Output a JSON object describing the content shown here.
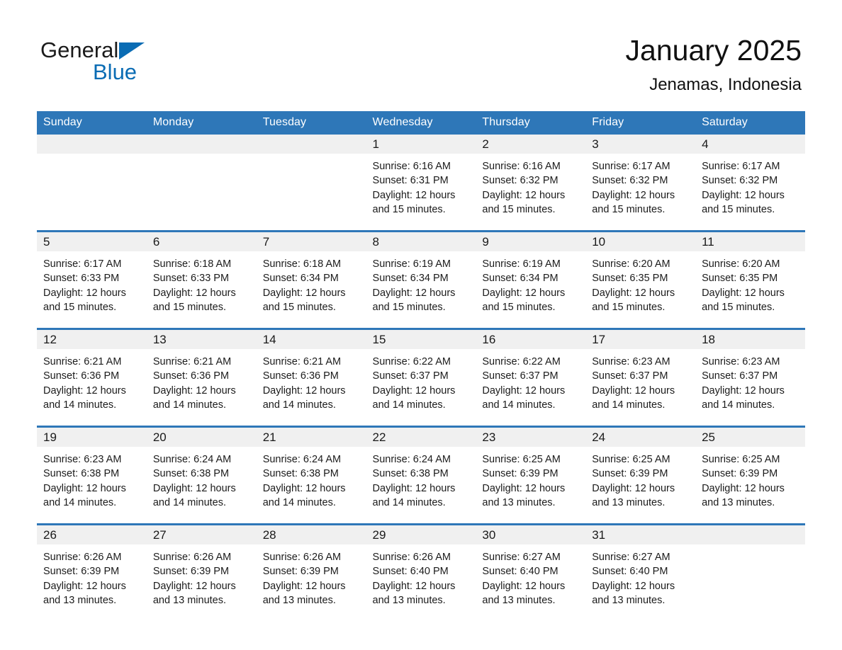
{
  "logo": {
    "word1": "General",
    "word2": "Blue",
    "triangle_color": "#0a6cb4",
    "triangle_name": "logo-triangle-icon"
  },
  "header": {
    "title": "January 2025",
    "subtitle": "Jenamas, Indonesia"
  },
  "theme": {
    "header_blue": "#2E77B8",
    "row_separator_blue": "#2E77B8",
    "daynum_band": "#f0f0f0",
    "text": "#1b1b1b",
    "header_text": "#ffffff"
  },
  "weekday_headers": [
    "Sunday",
    "Monday",
    "Tuesday",
    "Wednesday",
    "Thursday",
    "Friday",
    "Saturday"
  ],
  "weeks": [
    {
      "days": [
        {
          "num": "",
          "sunrise": "",
          "sunset": "",
          "daylight": "",
          "blank": true
        },
        {
          "num": "",
          "sunrise": "",
          "sunset": "",
          "daylight": "",
          "blank": true
        },
        {
          "num": "",
          "sunrise": "",
          "sunset": "",
          "daylight": "",
          "blank": true
        },
        {
          "num": "1",
          "sunrise": "Sunrise: 6:16 AM",
          "sunset": "Sunset: 6:31 PM",
          "daylight": "Daylight: 12 hours and 15 minutes.",
          "blank": false
        },
        {
          "num": "2",
          "sunrise": "Sunrise: 6:16 AM",
          "sunset": "Sunset: 6:32 PM",
          "daylight": "Daylight: 12 hours and 15 minutes.",
          "blank": false
        },
        {
          "num": "3",
          "sunrise": "Sunrise: 6:17 AM",
          "sunset": "Sunset: 6:32 PM",
          "daylight": "Daylight: 12 hours and 15 minutes.",
          "blank": false
        },
        {
          "num": "4",
          "sunrise": "Sunrise: 6:17 AM",
          "sunset": "Sunset: 6:32 PM",
          "daylight": "Daylight: 12 hours and 15 minutes.",
          "blank": false
        }
      ]
    },
    {
      "days": [
        {
          "num": "5",
          "sunrise": "Sunrise: 6:17 AM",
          "sunset": "Sunset: 6:33 PM",
          "daylight": "Daylight: 12 hours and 15 minutes.",
          "blank": false
        },
        {
          "num": "6",
          "sunrise": "Sunrise: 6:18 AM",
          "sunset": "Sunset: 6:33 PM",
          "daylight": "Daylight: 12 hours and 15 minutes.",
          "blank": false
        },
        {
          "num": "7",
          "sunrise": "Sunrise: 6:18 AM",
          "sunset": "Sunset: 6:34 PM",
          "daylight": "Daylight: 12 hours and 15 minutes.",
          "blank": false
        },
        {
          "num": "8",
          "sunrise": "Sunrise: 6:19 AM",
          "sunset": "Sunset: 6:34 PM",
          "daylight": "Daylight: 12 hours and 15 minutes.",
          "blank": false
        },
        {
          "num": "9",
          "sunrise": "Sunrise: 6:19 AM",
          "sunset": "Sunset: 6:34 PM",
          "daylight": "Daylight: 12 hours and 15 minutes.",
          "blank": false
        },
        {
          "num": "10",
          "sunrise": "Sunrise: 6:20 AM",
          "sunset": "Sunset: 6:35 PM",
          "daylight": "Daylight: 12 hours and 15 minutes.",
          "blank": false
        },
        {
          "num": "11",
          "sunrise": "Sunrise: 6:20 AM",
          "sunset": "Sunset: 6:35 PM",
          "daylight": "Daylight: 12 hours and 15 minutes.",
          "blank": false
        }
      ]
    },
    {
      "days": [
        {
          "num": "12",
          "sunrise": "Sunrise: 6:21 AM",
          "sunset": "Sunset: 6:36 PM",
          "daylight": "Daylight: 12 hours and 14 minutes.",
          "blank": false
        },
        {
          "num": "13",
          "sunrise": "Sunrise: 6:21 AM",
          "sunset": "Sunset: 6:36 PM",
          "daylight": "Daylight: 12 hours and 14 minutes.",
          "blank": false
        },
        {
          "num": "14",
          "sunrise": "Sunrise: 6:21 AM",
          "sunset": "Sunset: 6:36 PM",
          "daylight": "Daylight: 12 hours and 14 minutes.",
          "blank": false
        },
        {
          "num": "15",
          "sunrise": "Sunrise: 6:22 AM",
          "sunset": "Sunset: 6:37 PM",
          "daylight": "Daylight: 12 hours and 14 minutes.",
          "blank": false
        },
        {
          "num": "16",
          "sunrise": "Sunrise: 6:22 AM",
          "sunset": "Sunset: 6:37 PM",
          "daylight": "Daylight: 12 hours and 14 minutes.",
          "blank": false
        },
        {
          "num": "17",
          "sunrise": "Sunrise: 6:23 AM",
          "sunset": "Sunset: 6:37 PM",
          "daylight": "Daylight: 12 hours and 14 minutes.",
          "blank": false
        },
        {
          "num": "18",
          "sunrise": "Sunrise: 6:23 AM",
          "sunset": "Sunset: 6:37 PM",
          "daylight": "Daylight: 12 hours and 14 minutes.",
          "blank": false
        }
      ]
    },
    {
      "days": [
        {
          "num": "19",
          "sunrise": "Sunrise: 6:23 AM",
          "sunset": "Sunset: 6:38 PM",
          "daylight": "Daylight: 12 hours and 14 minutes.",
          "blank": false
        },
        {
          "num": "20",
          "sunrise": "Sunrise: 6:24 AM",
          "sunset": "Sunset: 6:38 PM",
          "daylight": "Daylight: 12 hours and 14 minutes.",
          "blank": false
        },
        {
          "num": "21",
          "sunrise": "Sunrise: 6:24 AM",
          "sunset": "Sunset: 6:38 PM",
          "daylight": "Daylight: 12 hours and 14 minutes.",
          "blank": false
        },
        {
          "num": "22",
          "sunrise": "Sunrise: 6:24 AM",
          "sunset": "Sunset: 6:38 PM",
          "daylight": "Daylight: 12 hours and 14 minutes.",
          "blank": false
        },
        {
          "num": "23",
          "sunrise": "Sunrise: 6:25 AM",
          "sunset": "Sunset: 6:39 PM",
          "daylight": "Daylight: 12 hours and 13 minutes.",
          "blank": false
        },
        {
          "num": "24",
          "sunrise": "Sunrise: 6:25 AM",
          "sunset": "Sunset: 6:39 PM",
          "daylight": "Daylight: 12 hours and 13 minutes.",
          "blank": false
        },
        {
          "num": "25",
          "sunrise": "Sunrise: 6:25 AM",
          "sunset": "Sunset: 6:39 PM",
          "daylight": "Daylight: 12 hours and 13 minutes.",
          "blank": false
        }
      ]
    },
    {
      "days": [
        {
          "num": "26",
          "sunrise": "Sunrise: 6:26 AM",
          "sunset": "Sunset: 6:39 PM",
          "daylight": "Daylight: 12 hours and 13 minutes.",
          "blank": false
        },
        {
          "num": "27",
          "sunrise": "Sunrise: 6:26 AM",
          "sunset": "Sunset: 6:39 PM",
          "daylight": "Daylight: 12 hours and 13 minutes.",
          "blank": false
        },
        {
          "num": "28",
          "sunrise": "Sunrise: 6:26 AM",
          "sunset": "Sunset: 6:39 PM",
          "daylight": "Daylight: 12 hours and 13 minutes.",
          "blank": false
        },
        {
          "num": "29",
          "sunrise": "Sunrise: 6:26 AM",
          "sunset": "Sunset: 6:40 PM",
          "daylight": "Daylight: 12 hours and 13 minutes.",
          "blank": false
        },
        {
          "num": "30",
          "sunrise": "Sunrise: 6:27 AM",
          "sunset": "Sunset: 6:40 PM",
          "daylight": "Daylight: 12 hours and 13 minutes.",
          "blank": false
        },
        {
          "num": "31",
          "sunrise": "Sunrise: 6:27 AM",
          "sunset": "Sunset: 6:40 PM",
          "daylight": "Daylight: 12 hours and 13 minutes.",
          "blank": false
        },
        {
          "num": "",
          "sunrise": "",
          "sunset": "",
          "daylight": "",
          "blank": true
        }
      ]
    }
  ]
}
